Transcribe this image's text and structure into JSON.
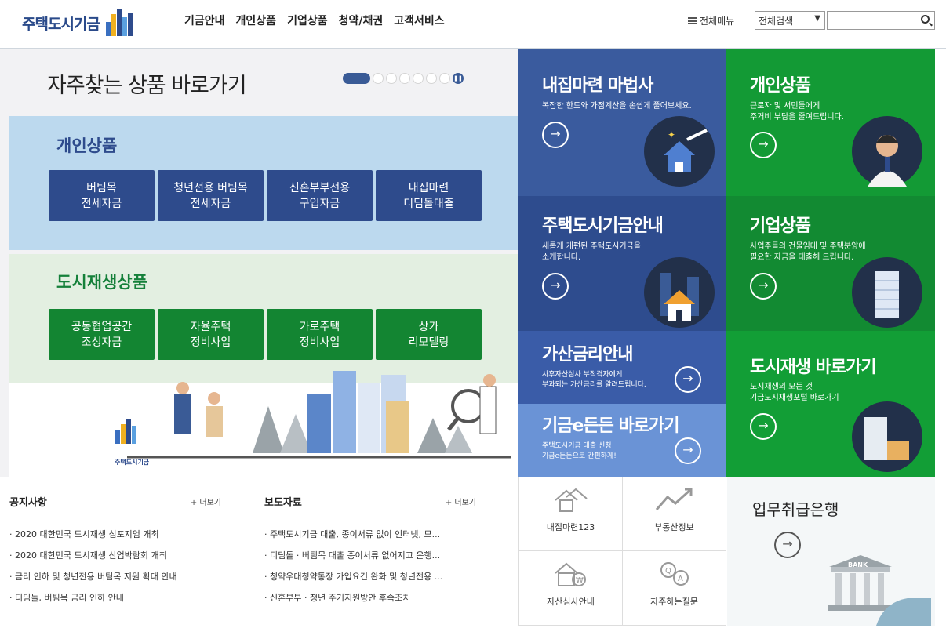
{
  "header": {
    "logo_text": "주택도시기금",
    "nav": [
      "기금안내",
      "개인상품",
      "기업상품",
      "청약/채권",
      "고객서비스"
    ],
    "all_menu": "전체메뉴",
    "search_select": "전체검색",
    "search_placeholder": ""
  },
  "favorites": {
    "title": "자주찾는 상품 바로가기",
    "personal": {
      "heading": "개인상품",
      "items": [
        {
          "l1": "버팀목",
          "l2": "전세자금"
        },
        {
          "l1": "청년전용 버팀목",
          "l2": "전세자금"
        },
        {
          "l1": "신혼부부전용",
          "l2": "구입자금"
        },
        {
          "l1": "내집마련",
          "l2": "디딤돌대출"
        }
      ]
    },
    "urban": {
      "heading": "도시재생상품",
      "items": [
        {
          "l1": "공동협업공간",
          "l2": "조성자금"
        },
        {
          "l1": "자율주택",
          "l2": "정비사업"
        },
        {
          "l1": "가로주택",
          "l2": "정비사업"
        },
        {
          "l1": "상가",
          "l2": "리모델링"
        }
      ]
    },
    "illus_logo": "주택도시기금"
  },
  "tiles": {
    "wizard": {
      "title": "내집마련 마법사",
      "desc": "복잡한 한도와 가점계산을 손쉽게 풀어보세요."
    },
    "personal": {
      "title": "개인상품",
      "desc1": "근로자 및 서민들에게",
      "desc2": "주거비 부담을 줄여드립니다."
    },
    "guide": {
      "title": "주택도시기금안내",
      "desc1": "새롭게 개편된 주택도시기금을",
      "desc2": "소개합니다."
    },
    "corporate": {
      "title": "기업상품",
      "desc1": "사업주들의 건물임대 및 주택분양에",
      "desc2": "필요한 자금을 대출해 드립니다."
    },
    "rate": {
      "title": "가산금리안내",
      "desc1": "사후자산심사 부적격자에게",
      "desc2": "부과되는 가산금리를 알려드립니다."
    },
    "urban": {
      "title": "도시재생 바로가기",
      "desc1": "도시재생의 모든 것",
      "desc2": "기금도시재생포털 바로가기"
    },
    "edeun": {
      "title": "기금e든든 바로가기",
      "desc1": "주택도시기금 대출 신청",
      "desc2": "기금e든든으로 간편하게!"
    }
  },
  "notice": {
    "heading": "공지사항",
    "more": "+ 더보기",
    "items": [
      "2020 대한민국 도시재생 심포지엄 개최",
      "2020 대한민국 도시재생 산업박람회 개최",
      "금리 인하 및 청년전용 버팀목 지원 확대 안내",
      "디딤돌, 버팀목 금리 인하 안내"
    ]
  },
  "press": {
    "heading": "보도자료",
    "more": "+ 더보기",
    "items": [
      "주택도시기금 대출, 종이서류 없이 인터넷, 모...",
      "디딤돌 · 버팀목 대출 종이서류 없어지고 은행...",
      "청약우대청약통장 가입요건 완화 및 청년전용 ...",
      "신혼부부 · 청년 주거지원방안 후속조치"
    ]
  },
  "quick": [
    {
      "label": "내집마련123",
      "icon": "house-icon"
    },
    {
      "label": "부동산정보",
      "icon": "chart-up-icon"
    },
    {
      "label": "자산심사안내",
      "icon": "money-house-icon"
    },
    {
      "label": "자주하는질문",
      "icon": "qa-icon"
    }
  ],
  "bank": {
    "title": "업무취급은행",
    "sign": "BANK"
  },
  "colors": {
    "navy": "#3a5b9e",
    "green": "#138532",
    "light_blue": "#6a93d6",
    "dark_navy": "#2e4b8c"
  }
}
